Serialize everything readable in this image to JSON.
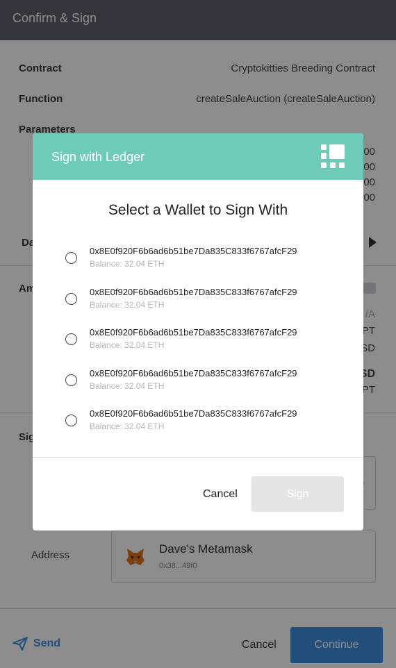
{
  "header": {
    "title": "Confirm & Sign"
  },
  "contract": {
    "label": "Contract",
    "value": "Cryptokitties Breeding Contract"
  },
  "function": {
    "label": "Function",
    "value": "createSaleAuction (createSaleAuction)"
  },
  "parameters": {
    "label": "Parameters",
    "visible_values": [
      "00",
      "00",
      "00",
      "00"
    ]
  },
  "data_section": {
    "label_partial": "Da"
  },
  "amount_section": {
    "label_partial": "Am",
    "visible_values": [
      "/A",
      "PT",
      "SD",
      "SD",
      "PT"
    ]
  },
  "signing_section": {
    "label_partial": "Sig",
    "field_hint": "e"
  },
  "address": {
    "label": "Address",
    "name": "Dave's Metamask",
    "short": "0x38...49f0"
  },
  "footer": {
    "send_label": "Send",
    "cancel_label": "Cancel",
    "continue_label": "Continue"
  },
  "modal": {
    "title": "Sign with Ledger",
    "heading": "Select a Wallet to Sign With",
    "wallets": [
      {
        "address": "0x8E0f920F6b6ad6b51be7Da835C833f6767afcF29",
        "balance": "Balance: 32.04 ETH"
      },
      {
        "address": "0x8E0f920F6b6ad6b51be7Da835C833f6767afcF29",
        "balance": "Balance: 32.04 ETH"
      },
      {
        "address": "0x8E0f920F6b6ad6b51be7Da835C833f6767afcF29",
        "balance": "Balance: 32.04 ETH"
      },
      {
        "address": "0x8E0f920F6b6ad6b51be7Da835C833f6767afcF29",
        "balance": "Balance: 32.04 ETH"
      },
      {
        "address": "0x8E0f920F6b6ad6b51be7Da835C833f6767afcF29",
        "balance": "Balance: 32.04 ETH"
      }
    ],
    "cancel_label": "Cancel",
    "sign_label": "Sign"
  },
  "colors": {
    "header_bg": "#5d6470",
    "modal_header_bg": "#6ecbb7",
    "accent_blue": "#3e8ee0",
    "disabled_button": "#e2e4e6"
  },
  "icons": {
    "ledger": "ledger-icon",
    "radio": "radio-unchecked-icon",
    "metamask": "fox-icon",
    "send": "paper-plane-icon",
    "expand": "triangle-right-icon"
  }
}
